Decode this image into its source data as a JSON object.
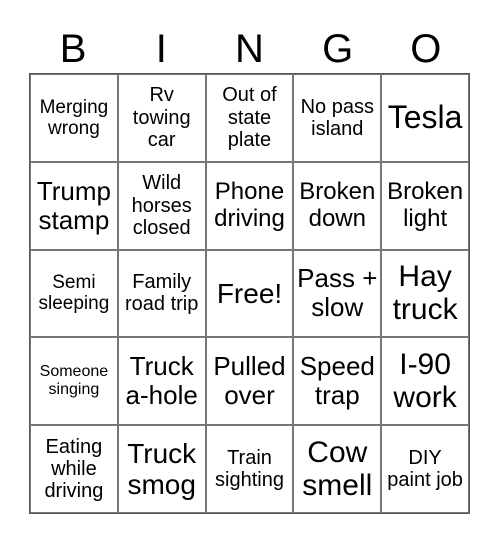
{
  "header": [
    "B",
    "I",
    "N",
    "G",
    "O"
  ],
  "cells": [
    "Merging wrong",
    "Rv towing car",
    "Out of state plate",
    "No pass island",
    "Tesla",
    "Trump stamp",
    "Wild horses closed",
    "Phone driving",
    "Broken down",
    "Broken light",
    "Semi sleeping",
    "Family road trip",
    "Free!",
    "Pass + slow",
    "Hay truck",
    "Someone singing",
    "Truck a-hole",
    "Pulled over",
    "Speed trap",
    "I-90 work",
    "Eating while driving",
    "Truck smog",
    "Train sighting",
    "Cow smell",
    "DIY paint job"
  ]
}
